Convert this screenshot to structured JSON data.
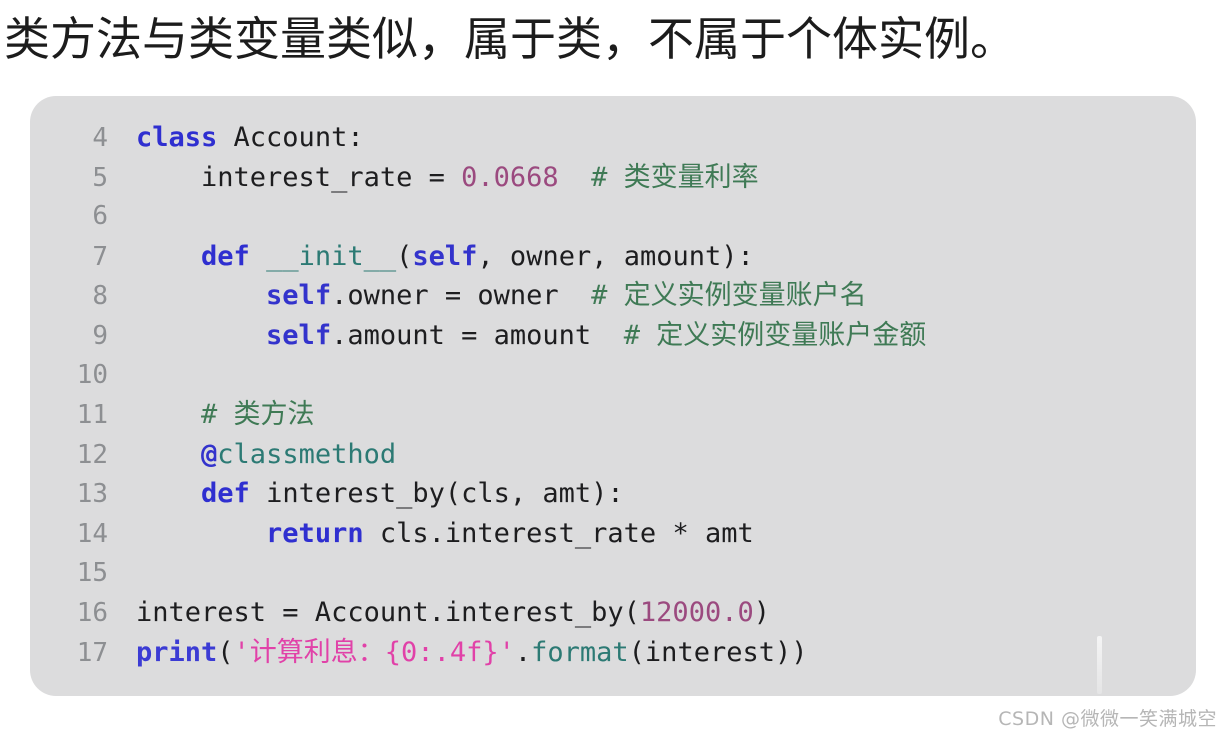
{
  "title": {
    "text": "类方法与类变量类似，属于类，不属于个体实例。"
  },
  "watermark": {
    "text": "CSDN @微微一笑满城空"
  },
  "code_panel": {
    "background_color": "#dcdcdd",
    "language": "python",
    "first_line_number": 4,
    "lines": [
      {
        "number": "4",
        "tokens": [
          {
            "t": "class",
            "c": "kw"
          },
          {
            "t": " Account:",
            "c": "plain"
          }
        ]
      },
      {
        "number": "5",
        "tokens": [
          {
            "t": "    interest_rate = ",
            "c": "plain"
          },
          {
            "t": "0.0668",
            "c": "num"
          },
          {
            "t": "  ",
            "c": "plain"
          },
          {
            "t": "# 类变量利率",
            "c": "cmt"
          }
        ]
      },
      {
        "number": "6",
        "tokens": [
          {
            "t": "",
            "c": "plain"
          }
        ]
      },
      {
        "number": "7",
        "tokens": [
          {
            "t": "    ",
            "c": "plain"
          },
          {
            "t": "def",
            "c": "kw"
          },
          {
            "t": " ",
            "c": "plain"
          },
          {
            "t": "__init__",
            "c": "fn"
          },
          {
            "t": "(",
            "c": "plain"
          },
          {
            "t": "self",
            "c": "self"
          },
          {
            "t": ", owner, amount):",
            "c": "plain"
          }
        ]
      },
      {
        "number": "8",
        "tokens": [
          {
            "t": "        ",
            "c": "plain"
          },
          {
            "t": "self",
            "c": "self"
          },
          {
            "t": ".owner = owner  ",
            "c": "plain"
          },
          {
            "t": "# 定义实例变量账户名",
            "c": "cmt"
          }
        ]
      },
      {
        "number": "9",
        "tokens": [
          {
            "t": "        ",
            "c": "plain"
          },
          {
            "t": "self",
            "c": "self"
          },
          {
            "t": ".amount = amount  ",
            "c": "plain"
          },
          {
            "t": "# 定义实例变量账户金额",
            "c": "cmt"
          }
        ]
      },
      {
        "number": "10",
        "tokens": [
          {
            "t": "",
            "c": "plain"
          }
        ]
      },
      {
        "number": "11",
        "tokens": [
          {
            "t": "    ",
            "c": "plain"
          },
          {
            "t": "# 类方法",
            "c": "cmt"
          }
        ]
      },
      {
        "number": "12",
        "tokens": [
          {
            "t": "    ",
            "c": "plain"
          },
          {
            "t": "@",
            "c": "at"
          },
          {
            "t": "classmethod",
            "c": "deco"
          }
        ]
      },
      {
        "number": "13",
        "tokens": [
          {
            "t": "    ",
            "c": "plain"
          },
          {
            "t": "def",
            "c": "kw"
          },
          {
            "t": " interest_by(cls, amt):",
            "c": "plain"
          }
        ]
      },
      {
        "number": "14",
        "tokens": [
          {
            "t": "        ",
            "c": "plain"
          },
          {
            "t": "return",
            "c": "kw"
          },
          {
            "t": " cls.interest_rate * amt",
            "c": "plain"
          }
        ]
      },
      {
        "number": "15",
        "tokens": [
          {
            "t": "",
            "c": "plain"
          }
        ]
      },
      {
        "number": "16",
        "tokens": [
          {
            "t": "interest = Account.interest_by(",
            "c": "plain"
          },
          {
            "t": "12000.0",
            "c": "num"
          },
          {
            "t": ")",
            "c": "plain"
          }
        ]
      },
      {
        "number": "17",
        "tokens": [
          {
            "t": "print",
            "c": "builtin"
          },
          {
            "t": "(",
            "c": "plain"
          },
          {
            "t": "'计算利息：{0:.4f}'",
            "c": "str"
          },
          {
            "t": ".",
            "c": "plain"
          },
          {
            "t": "format",
            "c": "fn"
          },
          {
            "t": "(interest))",
            "c": "plain"
          }
        ]
      }
    ]
  },
  "colors": {
    "keyword": "#2f2fd0",
    "function": "#2c7a74",
    "number": "#9b4a7f",
    "string": "#e141a8",
    "comment": "#3f7a55",
    "plain": "#1d1d1f",
    "gutter": "#8d8f92",
    "panel_bg": "#dcdcdd",
    "page_bg": "#ffffff",
    "title": "#1c1c1c",
    "watermark": "#b6b6b6"
  }
}
